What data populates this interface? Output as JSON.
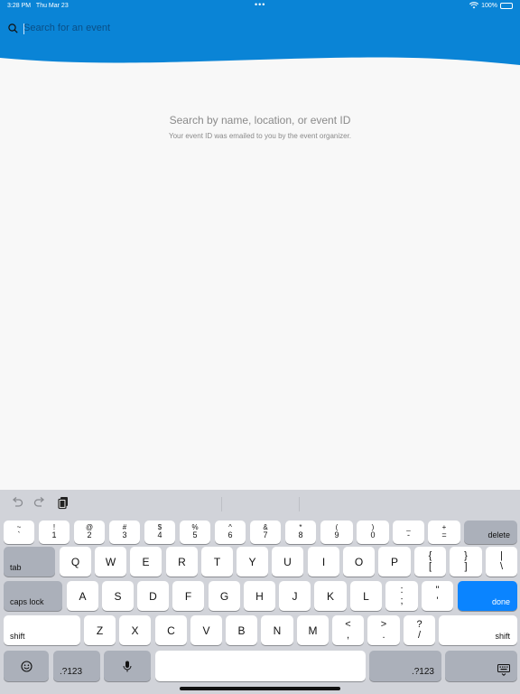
{
  "status": {
    "time": "3:28 PM",
    "date": "Thu Mar 23",
    "battery": "100%"
  },
  "search": {
    "placeholder": "Search for an event",
    "value": ""
  },
  "empty_state": {
    "title": "Search by name, location, or event ID",
    "subtitle": "Your event ID was emailed to you by the event organizer."
  },
  "colors": {
    "header": "#0a84d6",
    "background": "#f8f8f8",
    "keyboard": "#d1d3d9",
    "done_key": "#0a84ff"
  },
  "keyboard": {
    "row1": [
      {
        "top": "~",
        "bottom": "`"
      },
      {
        "top": "!",
        "bottom": "1"
      },
      {
        "top": "@",
        "bottom": "2"
      },
      {
        "top": "#",
        "bottom": "3"
      },
      {
        "top": "$",
        "bottom": "4"
      },
      {
        "top": "%",
        "bottom": "5"
      },
      {
        "top": "^",
        "bottom": "6"
      },
      {
        "top": "&",
        "bottom": "7"
      },
      {
        "top": "*",
        "bottom": "8"
      },
      {
        "top": "(",
        "bottom": "9"
      },
      {
        "top": ")",
        "bottom": "0"
      },
      {
        "top": "_",
        "bottom": "-"
      },
      {
        "top": "+",
        "bottom": "="
      }
    ],
    "delete": "delete",
    "tab": "tab",
    "row2": [
      "Q",
      "W",
      "E",
      "R",
      "T",
      "Y",
      "U",
      "I",
      "O",
      "P"
    ],
    "row2_sym": [
      {
        "top": "{",
        "bottom": "["
      },
      {
        "top": "}",
        "bottom": "]"
      },
      {
        "top": "|",
        "bottom": "\\"
      }
    ],
    "caps": "caps lock",
    "row3": [
      "A",
      "S",
      "D",
      "F",
      "G",
      "H",
      "J",
      "K",
      "L"
    ],
    "row3_sym": [
      {
        "top": ":",
        "bottom": ";"
      },
      {
        "top": "\"",
        "bottom": "'"
      }
    ],
    "done": "done",
    "shift_left": "shift",
    "row4": [
      "Z",
      "X",
      "C",
      "V",
      "B",
      "N",
      "M"
    ],
    "row4_sym": [
      {
        "top": "<",
        "bottom": ","
      },
      {
        "top": ">",
        "bottom": "."
      },
      {
        "top": "?",
        "bottom": "/"
      }
    ],
    "shift_right": "shift",
    "num_left": ".?123",
    "num_right": ".?123"
  }
}
